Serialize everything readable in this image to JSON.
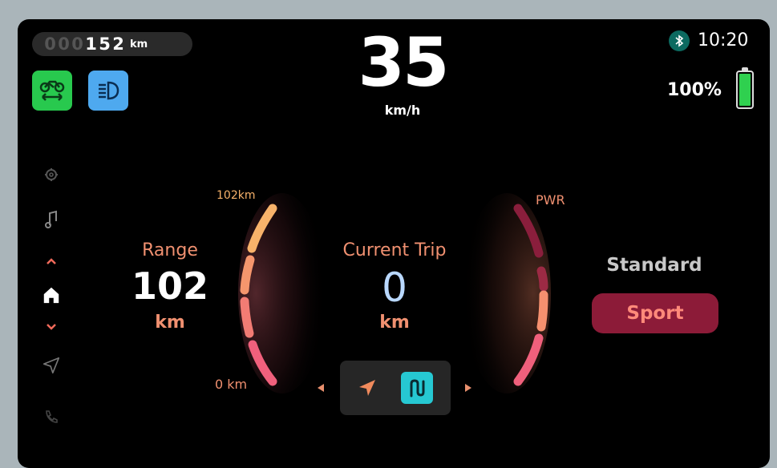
{
  "odometer": {
    "digits": [
      {
        "d": "0",
        "dim": true
      },
      {
        "d": "0",
        "dim": true
      },
      {
        "d": "0",
        "dim": true
      },
      {
        "d": "1",
        "dim": false
      },
      {
        "d": "5",
        "dim": false
      },
      {
        "d": "2",
        "dim": false
      }
    ],
    "unit": "km"
  },
  "mode_icons": [
    {
      "name": "motorcycle-icon",
      "color": "#28c94e"
    },
    {
      "name": "headlight-icon",
      "color": "#4ea9ef"
    }
  ],
  "speed": {
    "value": "35",
    "unit": "km/h"
  },
  "status": {
    "bluetooth_icon": "bluetooth-icon",
    "time": "10:20",
    "battery_percent": "100%",
    "battery_level": 1.0
  },
  "sidebar": {
    "items": [
      "settings-icon",
      "music-icon",
      "chevron-up-icon",
      "home-icon",
      "chevron-down-icon",
      "navigation-icon",
      "phone-icon"
    ],
    "active": "home-icon"
  },
  "range": {
    "label": "Range",
    "value": "102",
    "unit": "km",
    "max_label": "102km",
    "min_label": "0 km"
  },
  "trip": {
    "label": "Current Trip",
    "value": "0",
    "unit": "km"
  },
  "power": {
    "label": "PWR"
  },
  "ride_modes": {
    "standard": "Standard",
    "sport": "Sport",
    "selected": "Sport"
  },
  "nav": {
    "direction_icon": "arrow-icon",
    "route_icon": "route-icon"
  },
  "colors": {
    "accent": "#f09070",
    "sport_bg": "#8c1b38",
    "route_btn": "#26c8d2"
  }
}
